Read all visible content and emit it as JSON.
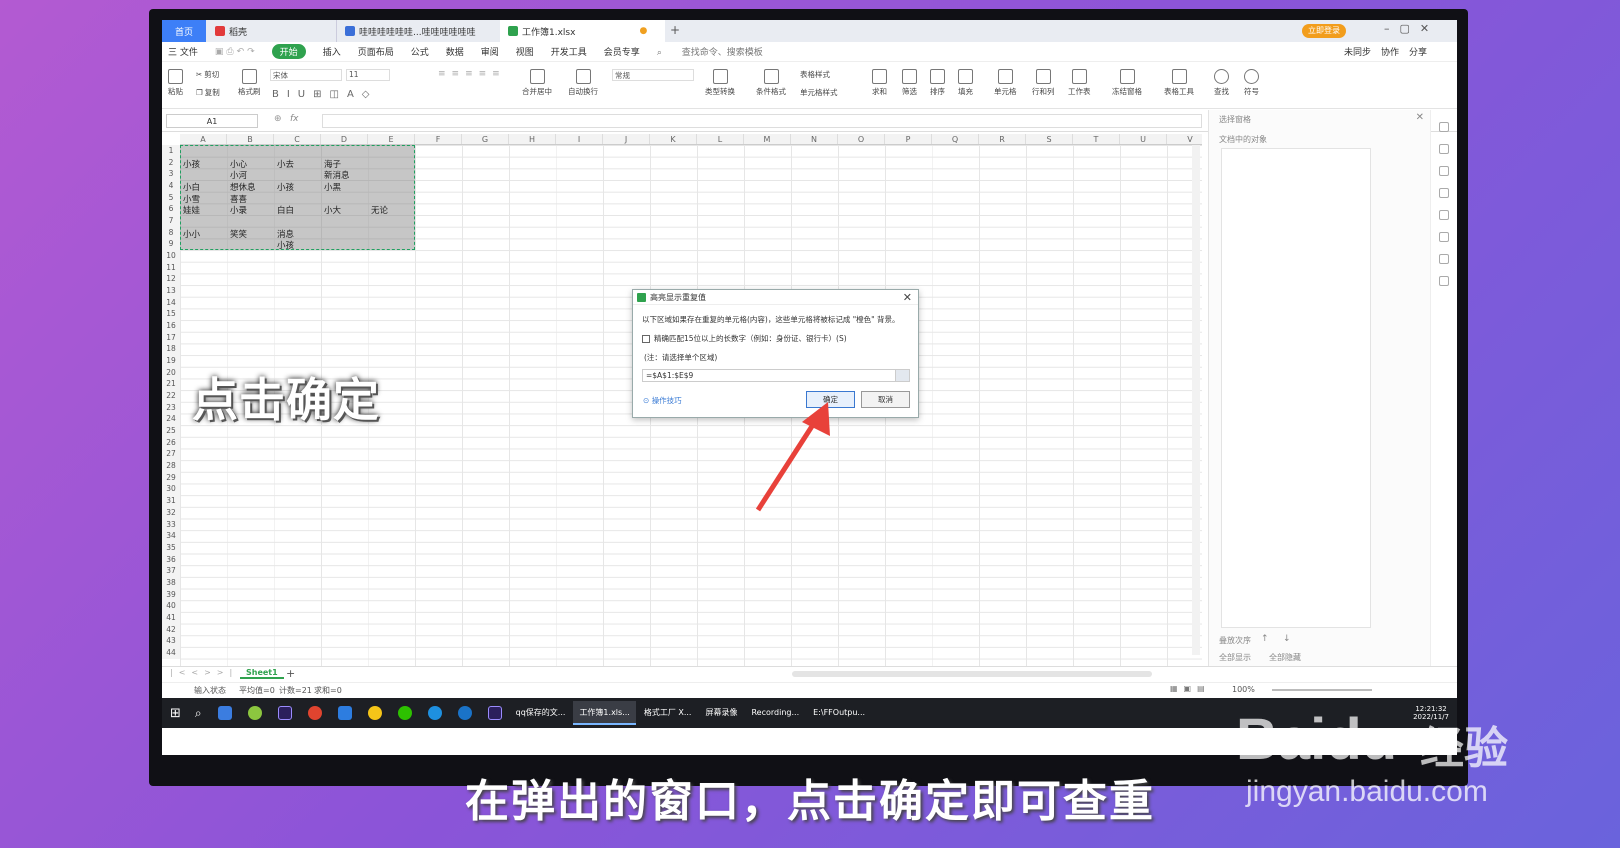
{
  "app": {
    "tabs": [
      {
        "label": "首页"
      },
      {
        "label": "稻壳"
      },
      {
        "label": "哇哇哇哇哇哇...哇哇哇哇哇哇"
      },
      {
        "label": "工作簿1.xlsx"
      }
    ],
    "login_label": "立即登录"
  },
  "menu": {
    "file": "三 文件",
    "items": [
      "开始",
      "插入",
      "页面布局",
      "公式",
      "数据",
      "审阅",
      "视图",
      "开发工具",
      "会员专享"
    ],
    "search_placeholder": "查找命令、搜索模板",
    "sync": "未同步",
    "collab": "协作",
    "share": "分享"
  },
  "ribbon": {
    "paste": "粘贴",
    "cut": "剪切",
    "copy": "复制",
    "format_painter": "格式刷",
    "font": "宋体",
    "font_size": "11",
    "merge": "合并居中",
    "wrap": "自动换行",
    "number_format": "常规",
    "convert": "类型转换",
    "cond_format": "条件格式",
    "table_style": "表格样式",
    "cell_style": "单元格样式",
    "sum": "求和",
    "filter": "筛选",
    "sort": "排序",
    "fill": "填充",
    "cells": "单元格",
    "rowcol": "行和列",
    "worksheet": "工作表",
    "freeze": "冻结窗格",
    "table_tools": "表格工具",
    "find": "查找",
    "symbol": "符号"
  },
  "formula_bar": {
    "name_box": "A1",
    "fx": "fx"
  },
  "sheet": {
    "columns": [
      "A",
      "B",
      "C",
      "D",
      "E",
      "F",
      "G",
      "H",
      "I",
      "J",
      "K",
      "L",
      "M",
      "N",
      "O",
      "P",
      "Q",
      "R",
      "S",
      "T",
      "U",
      "V"
    ],
    "rows": [
      "1",
      "2",
      "3",
      "4",
      "5",
      "6",
      "7",
      "8",
      "9",
      "10",
      "11",
      "12",
      "13",
      "14",
      "15",
      "16",
      "17",
      "18",
      "19",
      "20",
      "21",
      "22",
      "23",
      "24",
      "25",
      "26",
      "27",
      "28",
      "29",
      "30",
      "31",
      "32",
      "33",
      "34",
      "35",
      "36",
      "37",
      "38",
      "39",
      "40",
      "41",
      "42",
      "43",
      "44"
    ],
    "cells": {
      "A2": "小孩",
      "B2": "小心",
      "C2": "小去",
      "D2": "海子",
      "B3": "小河",
      "D3": "新消息",
      "A4": "小白",
      "B4": "想休息",
      "C4": "小孩",
      "D4": "小黑",
      "A5": "小雪",
      "B5": "喜喜",
      "A6": "娃娃",
      "B6": "小录",
      "C6": "白白",
      "D6": "小大",
      "E6": "无论",
      "A8": "小小",
      "B8": "笑笑",
      "C8": "消息",
      "C9": "小孩"
    },
    "sheet_tab": "Sheet1"
  },
  "overlay_text": "点击确定",
  "side_panel": {
    "title": "选择窗格",
    "subtitle": "文档中的对象",
    "order": "叠放次序",
    "show_all": "全部显示",
    "hide_all": "全部隐藏"
  },
  "status": {
    "mode": "输入状态",
    "avg": "平均值=0",
    "count": "计数=21",
    "sum": "求和=0",
    "zoom": "100%"
  },
  "dialog": {
    "title": "高亮显示重复值",
    "description": "以下区域如果存在重复的单元格(内容)，这些单元格将被标记成 \"橙色\" 背景。",
    "checkbox": "精确匹配15位以上的长数字（例如：身份证、银行卡）(S)",
    "note": "(注：请选择单个区域)",
    "range": "=$A$1:$E$9",
    "tips": "操作技巧",
    "ok": "确定",
    "cancel": "取消"
  },
  "taskbar": {
    "apps": [
      "qq保存的文...",
      "工作簿1.xls...",
      "格式工厂 X...",
      "屏幕录像",
      "Recording...",
      "E:\\FFOutpu..."
    ],
    "clock_time": "12:21:32",
    "clock_date": "2022/11/7"
  },
  "caption": "在弹出的窗口，点击确定即可查重",
  "watermark": {
    "brand": "Baidu",
    "cn": "经验",
    "url": "jingyan.baidu.com"
  },
  "colors": {
    "accent_green": "#2fa24e",
    "tab_blue": "#3d7ff7",
    "selection_border": "#20a060",
    "arrow_red": "#e8413a"
  }
}
